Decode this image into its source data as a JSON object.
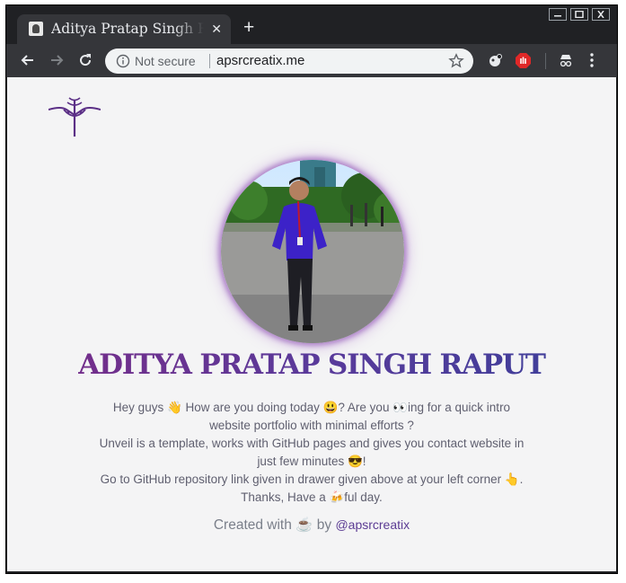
{
  "browser": {
    "tab_title": "Aditya Pratap Singh Raput",
    "tab_close": "✕",
    "new_tab": "+",
    "security_label": "Not secure",
    "url": "apsrcreatix.me"
  },
  "page": {
    "name": "ADITYA PRATAP SINGH RAPUT",
    "intro_lines": [
      "Hey guys 👋 How are you doing today 😃? Are you 👀ing for a quick intro",
      "website portfolio with minimal efforts ?",
      "Unveil is a template, works with GitHub pages and gives you contact website in",
      "just few minutes 😎!",
      "Go to GitHub repository link given in drawer given above at your left corner 👆.",
      "Thanks, Have a 🍻ful day."
    ],
    "credit_text": "Created with ☕ by",
    "credit_handle": "@apsrcreatix"
  },
  "colors": {
    "accent": "#5b3b93",
    "name_gradient_start": "#7a2a86",
    "name_gradient_end": "#3a3f9a"
  }
}
